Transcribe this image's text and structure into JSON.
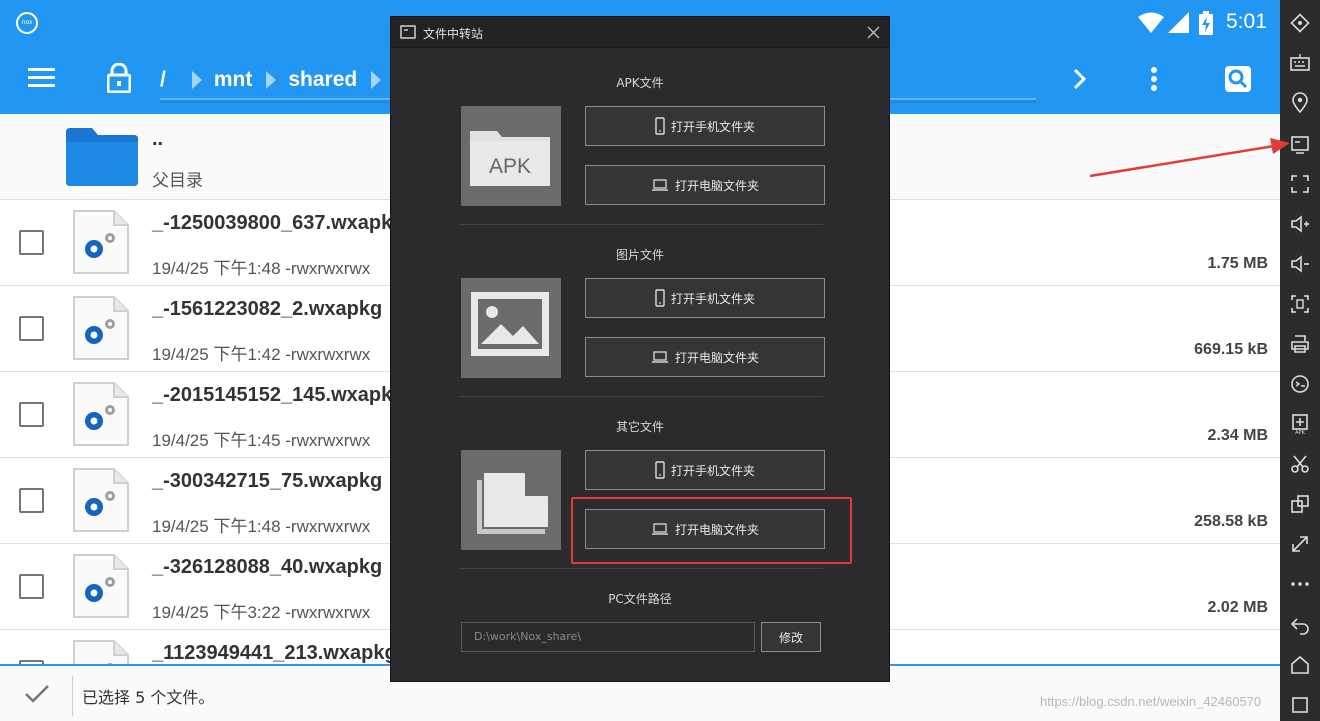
{
  "statusbar": {
    "time": "5:01",
    "app_icon": "nox-icon",
    "app_icon_label": "nox"
  },
  "toolbar": {
    "breadcrumbs": [
      "/",
      "mnt",
      "shared"
    ]
  },
  "files": {
    "parent": {
      "name": "..",
      "label": "父目录"
    },
    "rows": [
      {
        "name": "_-1250039800_637.wxapkg",
        "date": "19/4/25 下午1:48",
        "perms": "-rwxrwxrwx",
        "size": "1.75 MB"
      },
      {
        "name": "_-1561223082_2.wxapkg",
        "date": "19/4/25 下午1:42",
        "perms": "-rwxrwxrwx",
        "size": "669.15 kB"
      },
      {
        "name": "_-2015145152_145.wxapkg",
        "date": "19/4/25 下午1:45",
        "perms": "-rwxrwxrwx",
        "size": "2.34 MB"
      },
      {
        "name": "_-300342715_75.wxapkg",
        "date": "19/4/25 下午1:48",
        "perms": "-rwxrwxrwx",
        "size": "258.58 kB"
      },
      {
        "name": "_-326128088_40.wxapkg",
        "date": "19/4/25 下午3:22",
        "perms": "-rwxrwxrwx",
        "size": "2.02 MB"
      },
      {
        "name": "_1123949441_213.wxapkg",
        "date": "",
        "perms": "",
        "size": ""
      }
    ]
  },
  "bottombar": {
    "selection_text": "已选择 5 个文件。"
  },
  "dialog": {
    "title": "文件中转站",
    "sections": [
      {
        "title": "APK文件",
        "thumb_label": "APK",
        "phone_btn": "打开手机文件夹",
        "pc_btn": "打开电脑文件夹"
      },
      {
        "title": "图片文件",
        "phone_btn": "打开手机文件夹",
        "pc_btn": "打开电脑文件夹"
      },
      {
        "title": "其它文件",
        "phone_btn": "打开手机文件夹",
        "pc_btn": "打开电脑文件夹"
      }
    ],
    "pc_path": {
      "label": "PC文件路径",
      "value": "D:\\work\\Nox_share\\",
      "modify_btn": "修改"
    }
  },
  "sidebar": {
    "icons": [
      "rotate-icon",
      "keyboard-icon",
      "location-icon",
      "file-transfer-icon",
      "fullscreen-icon",
      "volume-up-icon",
      "volume-down-icon",
      "screenshot-icon",
      "printer-icon",
      "shake-icon",
      "apk-install-icon",
      "cut-icon",
      "multi-window-icon",
      "resize-icon",
      "more-icon",
      "back-icon",
      "home-icon",
      "recent-apps-icon"
    ]
  },
  "watermark": "https://blog.csdn.net/weixin_42460570",
  "colors": {
    "primary": "#2196f3",
    "dialog_bg": "#2b2b2d",
    "highlight": "#e53935",
    "sidebar_bg": "#2c2c2c"
  }
}
